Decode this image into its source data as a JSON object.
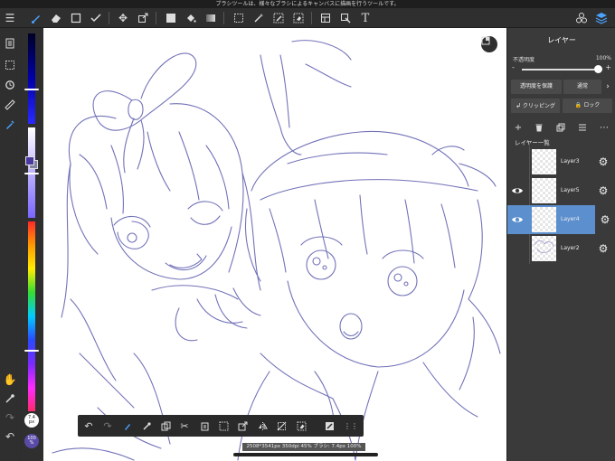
{
  "notice": "ブラシツールは、様々なブラシによるキャンバスに描画を行うツールです。",
  "toolbar": {
    "icons": [
      "menu-icon",
      "brush-icon",
      "eraser-icon",
      "rect-select-icon",
      "lasso-check-icon",
      "move-icon",
      "transform-icon",
      "fill-rect-icon",
      "bucket-icon",
      "gradient-icon",
      "select-rect-icon",
      "magic-wand-icon",
      "select-pen-icon",
      "select-eraser-icon",
      "ruler-grid-icon",
      "transform-select-icon",
      "text-icon",
      "material-icon",
      "layers-icon"
    ]
  },
  "colors": {
    "accent": "#4aa3ff",
    "panel_bg": "#3a3a3a",
    "selected_layer": "#5b8fce",
    "line_art": "#6b6bb5",
    "primary_color": "#4a3aa0"
  },
  "colorstrip": {
    "brush_size_label": "7.4\npx",
    "opacity_label": "100\n%"
  },
  "layer_panel": {
    "title": "レイヤー",
    "opacity_label": "不透明度",
    "opacity_value": "100%",
    "minus": "-",
    "plus": "+",
    "preserve_alpha": "透明度を保護",
    "blend_mode": "通常",
    "blend_arrow": "›",
    "clipping": "クリッピング",
    "lock": "ロック",
    "list_title": "レイヤー一覧",
    "layers": [
      {
        "name": "Layer3",
        "visible": false,
        "selected": false
      },
      {
        "name": "Layer5",
        "visible": true,
        "selected": false
      },
      {
        "name": "Layer4",
        "visible": true,
        "selected": true
      },
      {
        "name": "Layer2",
        "visible": false,
        "selected": false
      }
    ]
  },
  "status": "2508*3541px 350dpi 45% ブラシ: 7.4px 100%"
}
